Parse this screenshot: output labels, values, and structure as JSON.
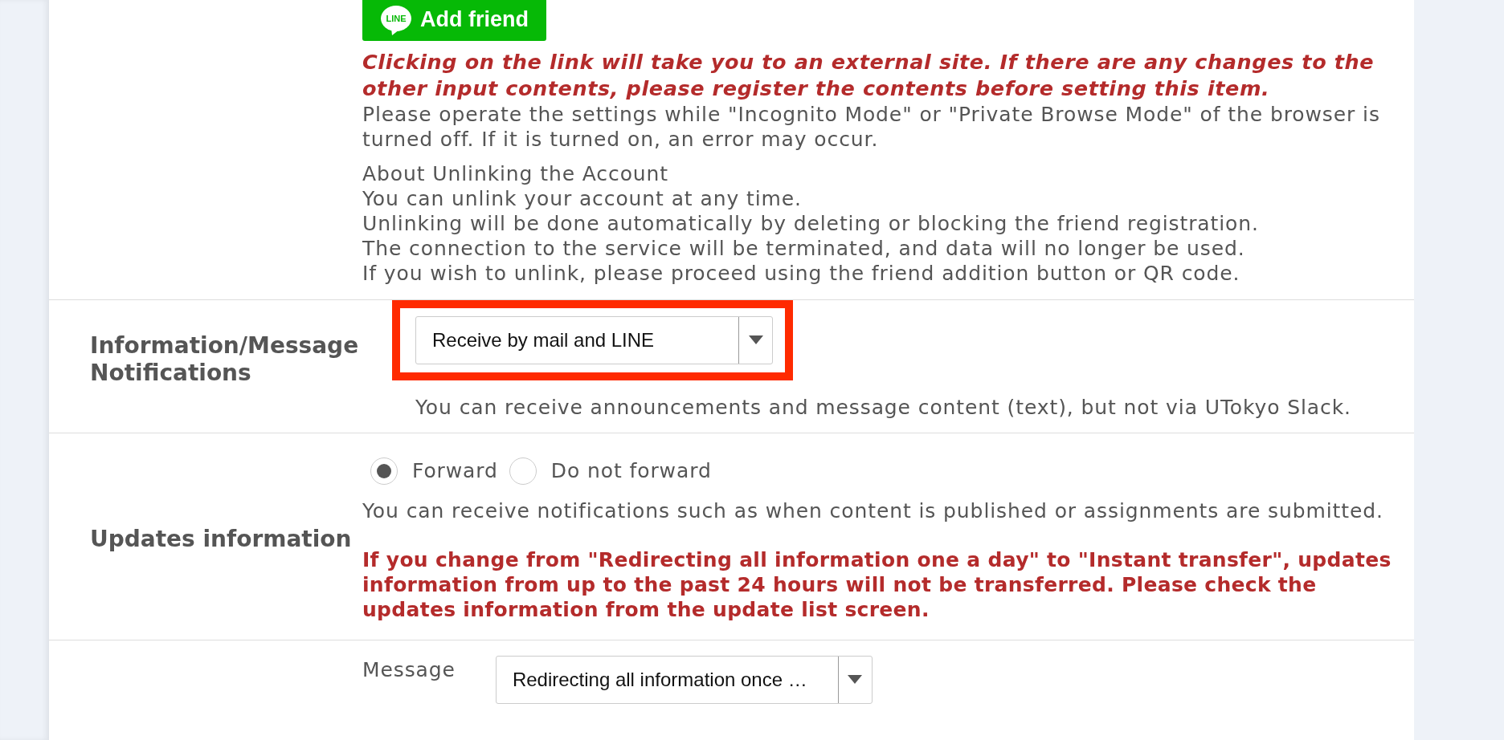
{
  "line_section": {
    "logo_label": "LINE",
    "button_label": "Add friend",
    "warning": "Clicking on the link will take you to an external site. If there are any changes to the other input contents, please register the contents before setting this item.",
    "note": "Please operate the settings while \"Incognito Mode\" or \"Private Browse Mode\" of the browser is turned off. If it is turned on, an error may occur.",
    "unlink_lines": [
      "About Unlinking the Account",
      "You can unlink your account at any time.",
      "Unlinking will be done automatically by deleting or blocking the friend registration.",
      "The connection to the service will be terminated, and data will no longer be used.",
      "If you wish to unlink, please proceed using the friend addition button or QR code."
    ]
  },
  "rows": [
    {
      "kind": "select",
      "label": "Information/Message Notifications",
      "select": {
        "value": "Receive by mail and LINE",
        "highlighted": true
      },
      "hint": "You can receive announcements and message content (text), but not via UTokyo Slack."
    },
    {
      "kind": "radio",
      "label": "Updates information",
      "options": [
        {
          "label": "Forward",
          "selected": true
        },
        {
          "label": "Do not forward",
          "selected": false
        }
      ],
      "hint": "You can receive notifications such as when content is published or assignments are submitted.",
      "warning": "If you change from \"Redirecting all information one a day\" to \"Instant transfer\", updates information from up to the past 24 hours will not be transferred. Please check the updates information from the update list screen."
    },
    {
      "kind": "fields",
      "fields": [
        {
          "label": "Message",
          "value": "Redirecting all information once …"
        }
      ]
    }
  ]
}
